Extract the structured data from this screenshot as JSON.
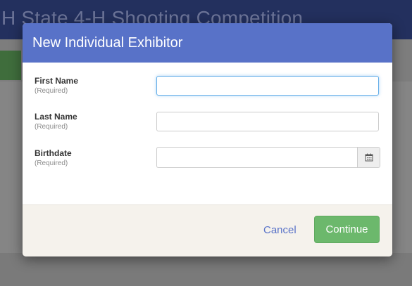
{
  "background": {
    "page_title": "H State 4-H Shooting Competition"
  },
  "modal": {
    "title": "New Individual Exhibitor",
    "fields": [
      {
        "label": "First Name",
        "sublabel": "(Required)",
        "value": ""
      },
      {
        "label": "Last Name",
        "sublabel": "(Required)",
        "value": ""
      },
      {
        "label": "Birthdate",
        "sublabel": "(Required)",
        "value": "",
        "icon": "calendar-icon"
      }
    ],
    "footer": {
      "cancel_label": "Cancel",
      "continue_label": "Continue"
    }
  },
  "colors": {
    "header_blue": "#5872c8",
    "continue_green": "#6cb86c",
    "footer_bg": "#f5f2ec"
  }
}
